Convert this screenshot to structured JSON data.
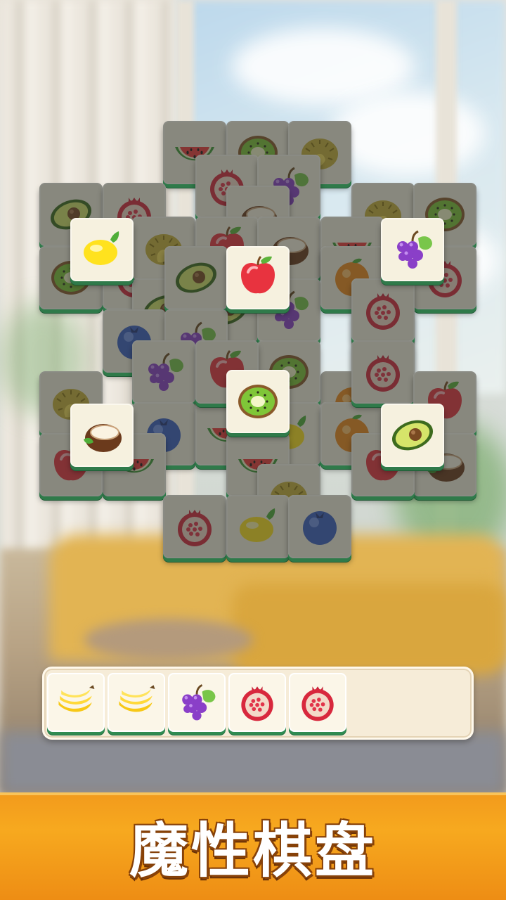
{
  "banner": {
    "title": "魔性棋盘"
  },
  "palette": {
    "tile_face": "#f6f1df",
    "tile_edge": "#2f7a4a",
    "banner": "#f29a1c"
  },
  "board": {
    "tiles": [
      {
        "fruit": "watermelon",
        "top": false
      },
      {
        "fruit": "kiwi",
        "top": false
      },
      {
        "fruit": "durian",
        "top": false
      },
      {
        "fruit": "pomegranate",
        "top": false
      },
      {
        "fruit": "grapes",
        "top": false
      },
      {
        "fruit": "coconut",
        "top": false
      },
      {
        "fruit": "avocado",
        "top": false
      },
      {
        "fruit": "pomegranate",
        "top": false
      },
      {
        "fruit": "durian",
        "top": false
      },
      {
        "fruit": "kiwi",
        "top": false
      },
      {
        "fruit": "kiwi",
        "top": false
      },
      {
        "fruit": "pomegranate",
        "top": false
      },
      {
        "fruit": "durian",
        "top": false
      },
      {
        "fruit": "apple",
        "top": false
      },
      {
        "fruit": "coconut",
        "top": false
      },
      {
        "fruit": "watermelon",
        "top": false
      },
      {
        "fruit": "pomegranate",
        "top": false
      },
      {
        "fruit": "avocado",
        "top": false
      },
      {
        "fruit": "blueberry",
        "top": false
      },
      {
        "fruit": "avocado",
        "top": false
      },
      {
        "fruit": "grapes",
        "top": false
      },
      {
        "fruit": "blueberry",
        "top": false
      },
      {
        "fruit": "avocado",
        "top": false
      },
      {
        "fruit": "orange",
        "top": false
      },
      {
        "fruit": "pomegranate",
        "top": false
      },
      {
        "fruit": "grapes",
        "top": false
      },
      {
        "fruit": "kiwi",
        "top": false
      },
      {
        "fruit": "orange",
        "top": false
      },
      {
        "fruit": "grapes",
        "top": false
      },
      {
        "fruit": "kiwi",
        "top": false
      },
      {
        "fruit": "durian",
        "top": false
      },
      {
        "fruit": "blueberry",
        "top": false
      },
      {
        "fruit": "watermelon",
        "top": false
      },
      {
        "fruit": "lemon",
        "top": false
      },
      {
        "fruit": "orange",
        "top": false
      },
      {
        "fruit": "apple",
        "top": false
      },
      {
        "fruit": "pomegranate",
        "top": false
      },
      {
        "fruit": "apple",
        "top": false
      },
      {
        "fruit": "watermelon",
        "top": false
      },
      {
        "fruit": "coconut",
        "top": false
      },
      {
        "fruit": "apple",
        "top": false
      },
      {
        "fruit": "watermelon",
        "top": false
      },
      {
        "fruit": "apple",
        "top": false
      },
      {
        "fruit": "durian",
        "top": false
      },
      {
        "fruit": "pomegranate",
        "top": false
      },
      {
        "fruit": "lemon",
        "top": false
      },
      {
        "fruit": "blueberry",
        "top": false
      },
      {
        "fruit": "lemon",
        "top": true
      },
      {
        "fruit": "apple",
        "top": true
      },
      {
        "fruit": "grapes",
        "top": true
      },
      {
        "fruit": "kiwi",
        "top": true
      },
      {
        "fruit": "coconut",
        "top": true
      },
      {
        "fruit": "avocado",
        "top": true
      }
    ]
  },
  "tray": {
    "capacity": 7,
    "slots": [
      "banana",
      "banana",
      "grapes",
      "pomegranate",
      "pomegranate"
    ]
  }
}
